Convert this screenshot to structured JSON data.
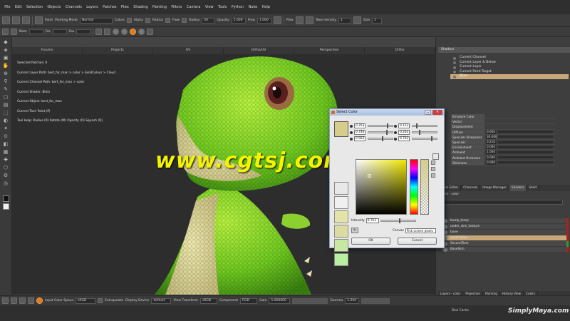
{
  "menubar": {
    "items": [
      "File",
      "Edit",
      "Selection",
      "Objects",
      "Channels",
      "Layers",
      "Patches",
      "Ptex",
      "Shading",
      "Painting",
      "Filters",
      "Camera",
      "View",
      "Tools",
      "Python",
      "Nuke",
      "Help"
    ]
  },
  "toolbar1": {
    "paint_label": "Paint",
    "painting_mode_label": "Painting Mode",
    "painting_mode_value": "Normal",
    "colors_label": "Colors",
    "alpha_label": "Alpha",
    "radius_label": "Radius",
    "flow_label": "Flow",
    "radius2_label": "Radius",
    "radius_value": "50",
    "opacity_label": "Opacity",
    "opacity_value": "1.000",
    "flow2_label": "Flow",
    "flow_value": "1.000",
    "ptex_label": "Ptex",
    "texel_density_label": "Texel density",
    "texel_density_value": "1",
    "size_label": "Size",
    "size_value": "1"
  },
  "toolbar2": {
    "near_label": "Near",
    "far_label": "Far",
    "fov_label": "Fov"
  },
  "viewport": {
    "tabs": [
      "Forums",
      "Projects",
      "UV",
      "Ortho/UV",
      "Perspective",
      "Ortho"
    ],
    "info": [
      "Selected Patches: 0",
      "Current Layer Path: bert_for_man > color > SolidColour > Cloud",
      "Current Channel Path: bert_for_man > color",
      "Current Shader: Blinn",
      "Current Object: bert_for_man",
      "Current Tool: Paint (P)",
      "Tool Help:   Radius (R)   Rotate (W)   Opacity (O)   Squash (Q)"
    ],
    "watermark": "www.cgtsj.com"
  },
  "shaders": {
    "title": "Shaders",
    "items": [
      "Current Channel",
      "Current Layer & Below",
      "Current Layer",
      "Current Paint Target",
      "Blinn"
    ],
    "active_index": 4
  },
  "properties": [
    {
      "name": "Emissive Color",
      "value": ""
    },
    {
      "name": "Vector",
      "value": ""
    },
    {
      "name": "Displacement",
      "value": ""
    },
    {
      "name": "Diffuse",
      "value": "0.600"
    },
    {
      "name": "Specular Sharpness",
      "value": "30.000"
    },
    {
      "name": "Specular",
      "value": "0.210"
    },
    {
      "name": "Environment",
      "value": "0.000"
    },
    {
      "name": "Ambient",
      "value": "1.000"
    },
    {
      "name": "Ambient Occlusion",
      "value": "0.000"
    },
    {
      "name": "Shininess",
      "value": "0.000"
    }
  ],
  "panel_tabs": [
    "Node Editor",
    "Channels",
    "Image Manager",
    "Shaders",
    "Shelf"
  ],
  "layers_title": "Layers - color",
  "layers": [
    {
      "name": "bump_temp",
      "active": false,
      "color": "#b02020"
    },
    {
      "name": "under_skin_texture",
      "active": false,
      "color": "#b02020"
    },
    {
      "name": "bone",
      "active": false,
      "color": "#b02020"
    },
    {
      "name": "SolidColour",
      "active": true,
      "color": "#b02020"
    },
    {
      "name": "SecondTone",
      "active": false,
      "color": "#2aa02a"
    },
    {
      "name": "BaseSkin",
      "active": false,
      "color": "#b02020"
    }
  ],
  "bottom_tabs": [
    "Layers - color",
    "Projection",
    "Painting",
    "History View",
    "Colors"
  ],
  "bottombar": {
    "input_color_space_label": "Input Color Space",
    "input_color_space_value": "sRGB",
    "extrapolate_label": "Extrapolate",
    "display_device_label": "Display Device",
    "display_device_value": "default",
    "view_transform_label": "View Transform",
    "view_transform_value": "sRGB",
    "component_label": "Component",
    "component_value": "RGB",
    "gain_label": "Gain",
    "gain_value": "1.000000",
    "gamma_label": "Gamma",
    "gamma_value": "1.000"
  },
  "status": {
    "disk_cache": "Disk Cache",
    "brand": "SimplyMaya.com"
  },
  "dialog": {
    "title": "Select Color",
    "min_symbol": "▭",
    "close_symbol": "✕",
    "current_color": "#d6cd8c",
    "rows": [
      {
        "value": "0.763",
        "slider": 0.75
      },
      {
        "value": "0.746",
        "slider": 0.73
      },
      {
        "value": "0.562",
        "slider": 0.55
      }
    ],
    "rows2": [
      {
        "value": "0.153",
        "slider": 0.15
      },
      {
        "value": "0.263",
        "slider": 0.26
      },
      {
        "value": "0.763",
        "slider": 0.75
      }
    ],
    "history": [
      "#e8e8e8",
      "#f0f0f0",
      "#e4e4a8",
      "#dcdca0",
      "#c8e8a0",
      "#b8f0a0"
    ],
    "intensity_label": "Intensity",
    "intensity_value": "0.763",
    "dropper_symbol": "✎",
    "canvas_label": "Canvas",
    "canvas_value": "Pick screen pixels",
    "ok_label": "OK",
    "cancel_label": "Cancel"
  },
  "toolbox": {
    "icons": [
      "◆",
      "◈",
      "▣",
      "✋",
      "⊕",
      "⚲",
      "✎",
      "▢",
      "▤",
      "⬚",
      "◐",
      "✦",
      "⊙",
      "◧",
      "▦",
      "✚",
      "⬡",
      "⚙",
      "◎"
    ],
    "fg_color": "#111111",
    "bg_color": "#f0f0f0"
  }
}
